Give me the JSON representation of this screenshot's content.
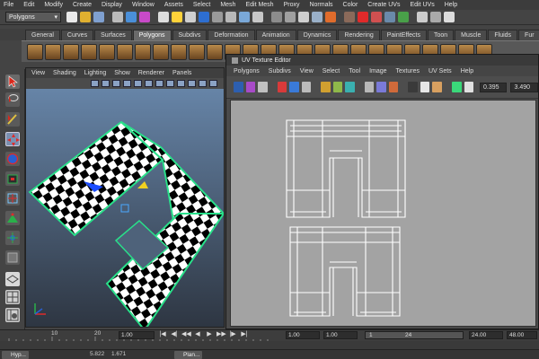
{
  "menubar": {
    "items": [
      "File",
      "Edit",
      "Modify",
      "Create",
      "Display",
      "Window",
      "Assets",
      "Select",
      "Mesh",
      "Edit Mesh",
      "Proxy",
      "Normals",
      "Color",
      "Create UVs",
      "Edit UVs",
      "Help"
    ]
  },
  "statusline": {
    "mode_value": "Polygons",
    "dropdown_glyph": "▾"
  },
  "shelf": {
    "tabs": [
      "General",
      "Curves",
      "Surfaces",
      "Polygons",
      "Subdivs",
      "Deformation",
      "Animation",
      "Dynamics",
      "Rendering",
      "PaintEffects",
      "Toon",
      "Muscle",
      "Fluids",
      "Fur"
    ],
    "active_tab": "Polygons"
  },
  "viewport": {
    "menu": [
      "View",
      "Shading",
      "Lighting",
      "Show",
      "Renderer",
      "Panels"
    ]
  },
  "uv_editor": {
    "title": "UV Texture Editor",
    "menu": [
      "Polygons",
      "Subdivs",
      "View",
      "Select",
      "Tool",
      "Image",
      "Textures",
      "UV Sets",
      "Help"
    ],
    "field_a": "0.395",
    "field_b": "3.490"
  },
  "timeline": {
    "ticks": [
      "10",
      "20"
    ],
    "current_frame": "1.00",
    "range_start": "1.00",
    "range_start_inner": "1.00",
    "range_slider_start": "1",
    "range_slider_end": "24",
    "range_end_inner": "24.00",
    "range_end": "48.00",
    "playback": [
      "|◀",
      "◀|",
      "◀◀",
      "◀",
      "▶",
      "▶▶",
      "|▶",
      "▶|"
    ]
  },
  "bottombar": {
    "coord_x": "5.822",
    "coord_y": "1.671",
    "task_items": [
      "Hyp...",
      "Plan..."
    ]
  },
  "colors": {
    "accent": "#7cc3e6",
    "checker_dark": "#000000",
    "checker_light": "#ffffff",
    "selection_green": "#29e08a"
  }
}
